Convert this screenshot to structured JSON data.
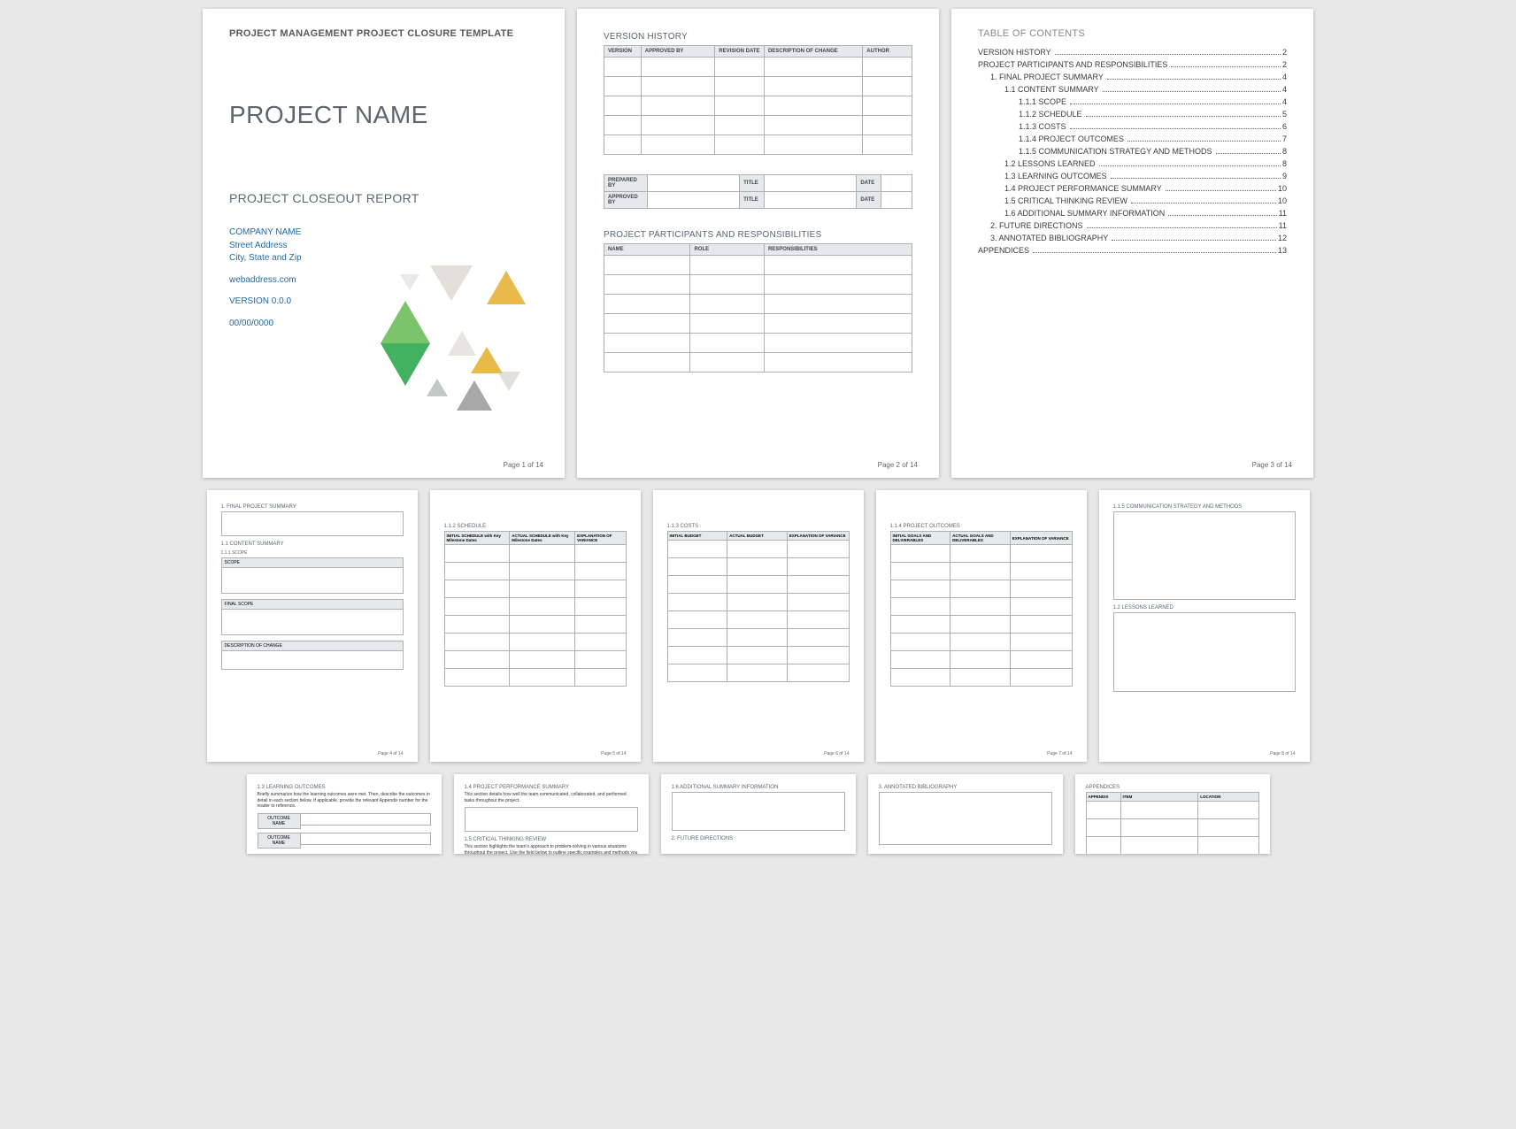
{
  "page1": {
    "header": "PROJECT MANAGEMENT PROJECT CLOSURE TEMPLATE",
    "title": "PROJECT NAME",
    "subtitle": "PROJECT CLOSEOUT REPORT",
    "company": "COMPANY NAME",
    "street": "Street Address",
    "citystate": "City, State and Zip",
    "web": "webaddress.com",
    "version": "VERSION 0.0.0",
    "date": "00/00/0000",
    "pagelabel": "Page 1 of 14"
  },
  "page2": {
    "vh_title": "VERSION HISTORY",
    "vh_headers": [
      "VERSION",
      "APPROVED BY",
      "REVISION DATE",
      "DESCRIPTION OF CHANGE",
      "AUTHOR"
    ],
    "approval_headers": [
      "PREPARED BY",
      "TITLE",
      "DATE"
    ],
    "approval_row2": "APPROVED BY",
    "pp_title": "PROJECT PARTICIPANTS AND RESPONSIBILITIES",
    "pp_headers": [
      "NAME",
      "ROLE",
      "RESPONSIBILITIES"
    ],
    "pagelabel": "Page 2 of 14"
  },
  "page3": {
    "title": "TABLE OF CONTENTS",
    "items": [
      {
        "indent": 0,
        "label": "VERSION HISTORY",
        "page": "2"
      },
      {
        "indent": 0,
        "label": "PROJECT PARTICIPANTS AND RESPONSIBILITIES",
        "page": "2"
      },
      {
        "indent": 1,
        "label": "1.   FINAL PROJECT SUMMARY",
        "page": "4"
      },
      {
        "indent": 2,
        "label": "1.1    CONTENT SUMMARY",
        "page": "4"
      },
      {
        "indent": 3,
        "label": "1.1.1   SCOPE",
        "page": "4"
      },
      {
        "indent": 3,
        "label": "1.1.2   SCHEDULE",
        "page": "5"
      },
      {
        "indent": 3,
        "label": "1.1.3   COSTS",
        "page": "6"
      },
      {
        "indent": 3,
        "label": "1.1.4   PROJECT OUTCOMES",
        "page": "7"
      },
      {
        "indent": 3,
        "label": "1.1.5   COMMUNICATION STRATEGY AND METHODS",
        "page": "8"
      },
      {
        "indent": 2,
        "label": "1.2    LESSONS LEARNED",
        "page": "8"
      },
      {
        "indent": 2,
        "label": "1.3    LEARNING OUTCOMES",
        "page": "9"
      },
      {
        "indent": 2,
        "label": "1.4    PROJECT PERFORMANCE SUMMARY",
        "page": "10"
      },
      {
        "indent": 2,
        "label": "1.5    CRITICAL THINKING REVIEW",
        "page": "10"
      },
      {
        "indent": 2,
        "label": "1.6    ADDITIONAL SUMMARY INFORMATION",
        "page": "11"
      },
      {
        "indent": 1,
        "label": "2.   FUTURE DIRECTIONS",
        "page": "11"
      },
      {
        "indent": 1,
        "label": "3.   ANNOTATED BIBLIOGRAPHY",
        "page": "12"
      },
      {
        "indent": 0,
        "label": "APPENDICES",
        "page": "13"
      }
    ],
    "pagelabel": "Page 3 of 14"
  },
  "page4": {
    "s1": "1.   FINAL PROJECT SUMMARY",
    "s2": "1.1   CONTENT SUMMARY",
    "s3": "1.1.1   SCOPE",
    "scope": "SCOPE",
    "finalscope": "FINAL SCOPE",
    "desc": "DESCRIPTION OF CHANGE",
    "pagelabel": "Page 4 of 14"
  },
  "page5": {
    "title": "1.1.2   SCHEDULE",
    "headers": [
      "INITIAL SCHEDULE with Key Milestone Dates",
      "ACTUAL SCHEDULE with Key Milestone Dates",
      "EXPLANATION OF VARIANCE"
    ],
    "pagelabel": "Page 5 of 14"
  },
  "page6": {
    "title": "1.1.3   COSTS",
    "headers": [
      "INITIAL BUDGET",
      "ACTUAL BUDGET",
      "EXPLANATION OF VARIANCE"
    ],
    "pagelabel": "Page 6 of 14"
  },
  "page7": {
    "title": "1.1.4   PROJECT OUTCOMES",
    "headers": [
      "INITIAL GOALS AND DELIVERABLES",
      "ACTUAL GOALS AND DELIVERABLES",
      "EXPLANATION OF VARIANCE"
    ],
    "pagelabel": "Page 7 of 14"
  },
  "page8": {
    "s1": "1.1.5   COMMUNICATION STRATEGY AND METHODS",
    "s2": "1.2   LESSONS LEARNED",
    "pagelabel": "Page 8 of 14"
  },
  "page9": {
    "s1": "1.3   LEARNING OUTCOMES",
    "body": "Briefly summarize how the learning outcomes were met. Then, describe the outcomes in detail in each section below. If applicable, provide the relevant Appendix number for the reader to reference.",
    "outlabel": "OUTCOME NAME"
  },
  "page10": {
    "s1": "1.4   PROJECT PERFORMANCE SUMMARY",
    "body1": "This section details how well the team communicated, collaborated, and performed tasks throughout the project.",
    "s2": "1.5   CRITICAL THINKING REVIEW",
    "body2": "This section highlights the team's approach to problem-solving in various situations throughout the project. Use the field below to outline specific examples and methods you used."
  },
  "page11": {
    "s1": "1.6   ADDITIONAL SUMMARY INFORMATION",
    "s2": "2.   FUTURE DIRECTIONS"
  },
  "page12": {
    "s1": "3.   ANNOTATED BIBLIOGRAPHY"
  },
  "page13": {
    "s1": "APPENDICES",
    "headers": [
      "APPENDIX",
      "ITEM",
      "LOCATION"
    ]
  }
}
